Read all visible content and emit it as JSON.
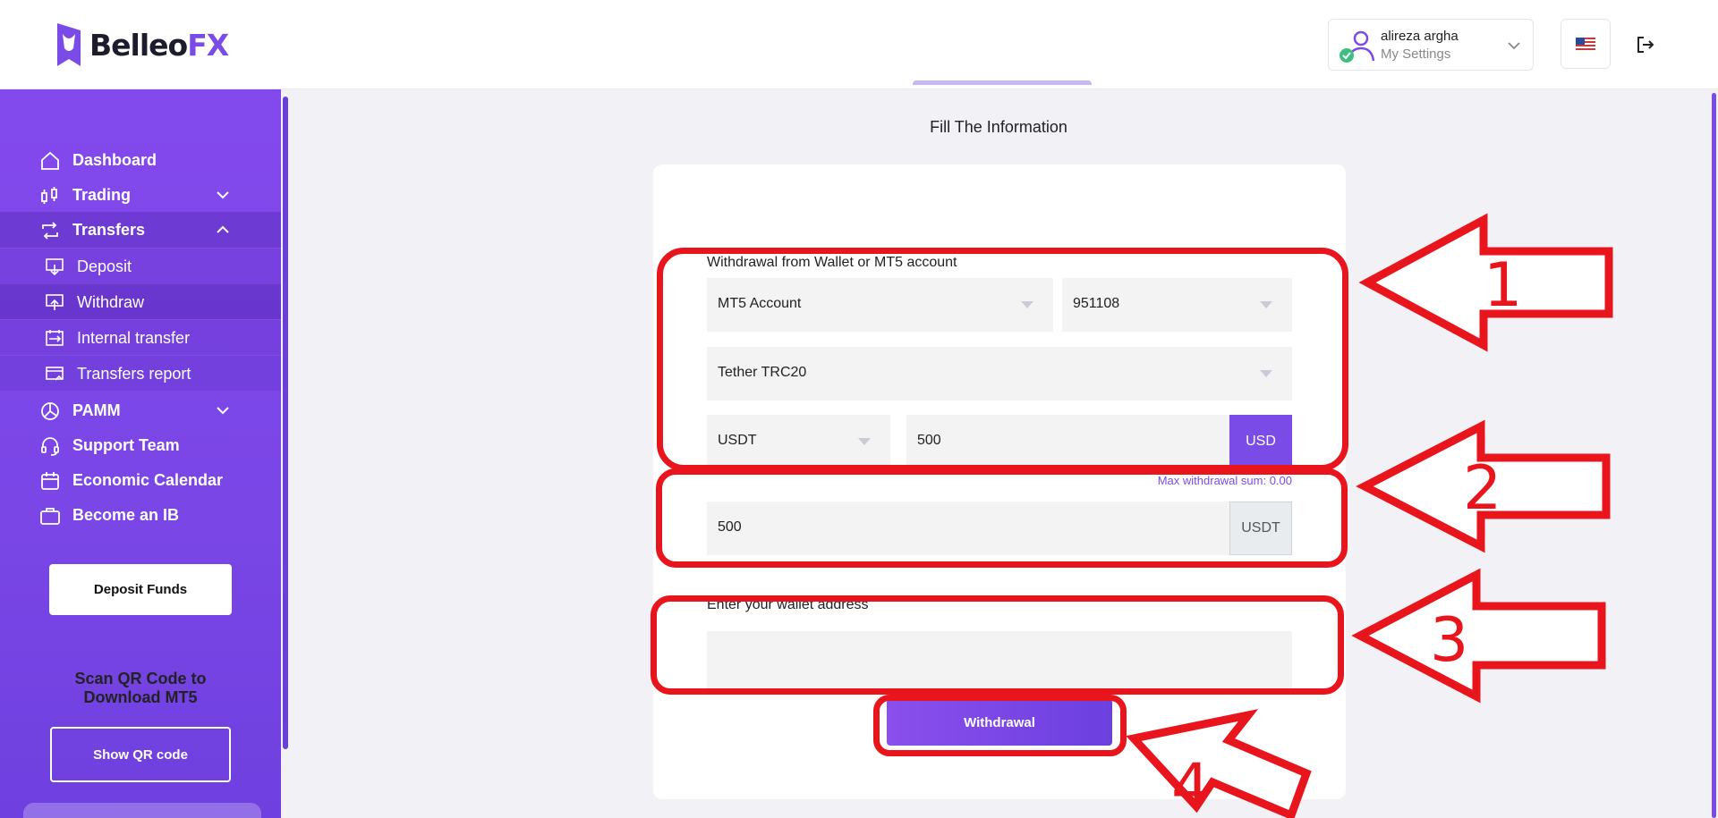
{
  "header": {
    "logo_main": "Belleo",
    "logo_accent": "FX",
    "user_name": "alireza argha",
    "user_settings": "My Settings"
  },
  "sidebar": {
    "items": [
      {
        "label": "Dashboard",
        "icon": "home-icon"
      },
      {
        "label": "Trading",
        "icon": "candlestick-icon"
      },
      {
        "label": "Transfers",
        "icon": "transfer-icon"
      },
      {
        "label": "PAMM",
        "icon": "pie-chart-icon"
      },
      {
        "label": "Support Team",
        "icon": "headset-icon"
      },
      {
        "label": "Economic Calendar",
        "icon": "calendar-icon"
      },
      {
        "label": "Become an IB",
        "icon": "briefcase-icon"
      }
    ],
    "sub_items": [
      {
        "label": "Deposit",
        "icon": "deposit-icon"
      },
      {
        "label": "Withdraw",
        "icon": "withdraw-icon"
      },
      {
        "label": "Internal transfer",
        "icon": "internal-transfer-icon"
      },
      {
        "label": "Transfers report",
        "icon": "report-icon"
      }
    ],
    "deposit_button": "Deposit Funds",
    "qr_text": "Scan QR Code to Download MT5",
    "qr_button": "Show QR code"
  },
  "main": {
    "subtitle": "Fill The Information",
    "form": {
      "source_label": "Withdrawal from Wallet or MT5 account",
      "account_type": "MT5 Account",
      "account_number": "951108",
      "method": "Tether TRC20",
      "currency": "USDT",
      "amount": "500",
      "amount_unit": "USD",
      "max_note": "Max withdrawal sum: 0.00",
      "converted_amount": "500",
      "converted_unit": "USDT",
      "wallet_label": "Enter your wallet address",
      "wallet_value": "",
      "submit_label": "Withdrawal"
    }
  },
  "annotations": {
    "color": "#e8151c",
    "numbers": [
      "1",
      "2",
      "3",
      "4"
    ]
  },
  "colors": {
    "accent": "#7b4be8",
    "sidebar": "#8349ec"
  }
}
